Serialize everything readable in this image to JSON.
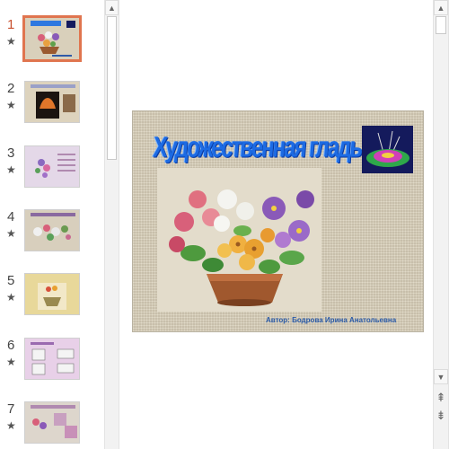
{
  "slides": [
    {
      "number": "1",
      "star": "★",
      "active": true
    },
    {
      "number": "2",
      "star": "★"
    },
    {
      "number": "3",
      "star": "★"
    },
    {
      "number": "4",
      "star": "★"
    },
    {
      "number": "5",
      "star": "★"
    },
    {
      "number": "6",
      "star": "★"
    },
    {
      "number": "7",
      "star": "★"
    }
  ],
  "slide": {
    "title": "Художественная гладь",
    "author": "Автор: Бодрова Ирина Анатольевна"
  },
  "scroll": {
    "up_glyph": "▲",
    "down_glyph": "▼",
    "prev_slide_glyph": "⇞",
    "next_slide_glyph": "⇟"
  },
  "colors": {
    "accent": "#e0754f",
    "title_blue": "#1d6be3",
    "slide_bg": "#d8cfb9"
  }
}
